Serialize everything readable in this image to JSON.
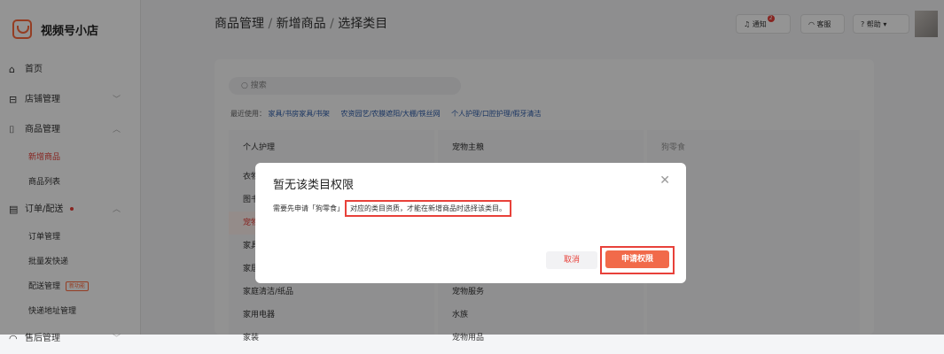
{
  "app": {
    "name": "视频号小店"
  },
  "sidebar": {
    "items": [
      {
        "label": "首页"
      },
      {
        "label": "店铺管理"
      },
      {
        "label": "商品管理"
      },
      {
        "label": "新增商品"
      },
      {
        "label": "商品列表"
      },
      {
        "label": "订单/配送"
      },
      {
        "label": "订单管理"
      },
      {
        "label": "批量发快递"
      },
      {
        "label": "配送管理",
        "badge": "新功能"
      },
      {
        "label": "快递地址管理"
      },
      {
        "label": "售后管理"
      }
    ]
  },
  "header": {
    "breadcrumb": [
      "商品管理",
      "新增商品",
      "选择类目"
    ],
    "separator": " / ",
    "notify": {
      "label": "通知",
      "count": "2"
    },
    "service": {
      "label": "客服"
    },
    "help": {
      "label": "帮助"
    }
  },
  "main": {
    "search_placeholder": "搜索",
    "recent_label": "最近使用：",
    "recent": [
      "家具/书房家具/书架",
      "农资园艺/农膜遮阳/大棚/铁丝网",
      "个人护理/口腔护理/假牙清洁"
    ],
    "columns": [
      {
        "header": "个人护理",
        "rows": [
          "衣物",
          "图书",
          "宠物",
          "家具",
          "家居",
          "家庭清洁/纸品",
          "家用电器",
          "家装"
        ]
      },
      {
        "header": "宠物主粮",
        "rows": [
          "",
          "",
          "",
          "",
          "",
          "宠物服务",
          "水族",
          "宠物用品"
        ]
      },
      {
        "header": "狗零食",
        "rows": []
      }
    ]
  },
  "dialog": {
    "title": "暂无该类目权限",
    "body_prefix": "需要先申请「狗零食」",
    "body_highlight": "对应的类目资质，才能在新增商品时选择该类目。",
    "cancel_label": "取消",
    "apply_label": "申请权限"
  },
  "colors": {
    "accent": "#e8413a",
    "brand_orange": "#ff6a3d",
    "apply_button": "#f16a4a"
  }
}
